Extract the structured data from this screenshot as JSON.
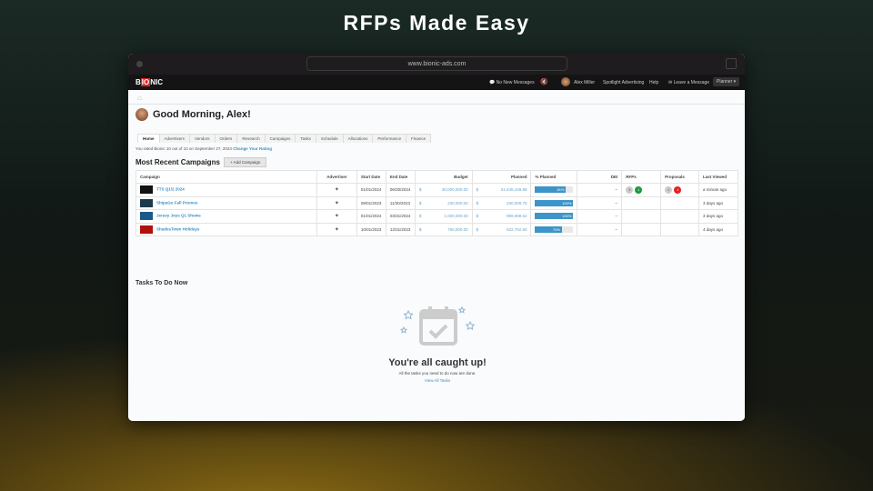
{
  "headline": "RFPs Made Easy",
  "browser": {
    "url": "www.bionic-ads.com"
  },
  "nav": {
    "logo": "BIONIC",
    "messages": "No New Messages",
    "user": "Alex Miller",
    "spotlight": "Spotlight Advertising",
    "help": "Help",
    "leave_message": "Leave a Message",
    "role": "Planner ▾"
  },
  "greeting": "Good Morning, Alex!",
  "tabs": [
    "Home",
    "Advertisers",
    "Vendors",
    "Orders",
    "Research",
    "Campaigns",
    "Tasks",
    "Schedule",
    "Allocations",
    "Performance",
    "Finance"
  ],
  "rating": {
    "text": "You rated Bionic 10 out of 10 on September 27, 2023",
    "link": "Change Your Rating"
  },
  "campaigns": {
    "title": "Most Recent Campaigns",
    "add_button": "+ Add Campaign",
    "columns": [
      "Campaign",
      "Advertiser",
      "Start Date",
      "End Date",
      "Budget",
      "Planned",
      "% Planned",
      "DEI",
      "RFPs",
      "Proposals",
      "Last Viewed"
    ],
    "rows": [
      {
        "name": "TTS Q1/2 2024",
        "start": "01/01/2024",
        "end": "06/30/2024",
        "budget_cur": "$",
        "budget": "30,000,000.00",
        "planned_cur": "$",
        "planned": "24,445,449.88",
        "pct": 81,
        "pct_label": "81%",
        "dei": "--",
        "rfps": [
          "3",
          "1"
        ],
        "proposals": [
          "1",
          "1"
        ],
        "last": "a minute ago",
        "thumb": "#111"
      },
      {
        "name": "ShipaGo Fall Promos",
        "start": "09/01/2023",
        "end": "11/30/2023",
        "budget_cur": "$",
        "budget": "230,000.00",
        "planned_cur": "$",
        "planned": "230,009.75",
        "pct": 100,
        "pct_label": "100%",
        "dei": "--",
        "last": "3 days ago",
        "thumb": "#1d3a4a"
      },
      {
        "name": "Jersey Joys Q1 Shows",
        "start": "01/01/2024",
        "end": "03/31/2024",
        "budget_cur": "$",
        "budget": "1,000,000.00",
        "planned_cur": "$",
        "planned": "999,999.62",
        "pct": 100,
        "pct_label": "100%",
        "dei": "--",
        "last": "3 days ago",
        "thumb": "#1a5a8a"
      },
      {
        "name": "ShadesTown Holidays",
        "start": "10/01/2023",
        "end": "12/31/2023",
        "budget_cur": "$",
        "budget": "750,000.00",
        "planned_cur": "$",
        "planned": "522,762.60",
        "pct": 70,
        "pct_label": "70%",
        "dei": "--",
        "last": "4 days ago",
        "thumb": "#b01010"
      }
    ]
  },
  "tasks": {
    "title": "Tasks To Do Now",
    "empty_title": "You're all caught up!",
    "empty_sub": "All the tasks you need to do now are done.",
    "view_all": "View All Tasks"
  }
}
